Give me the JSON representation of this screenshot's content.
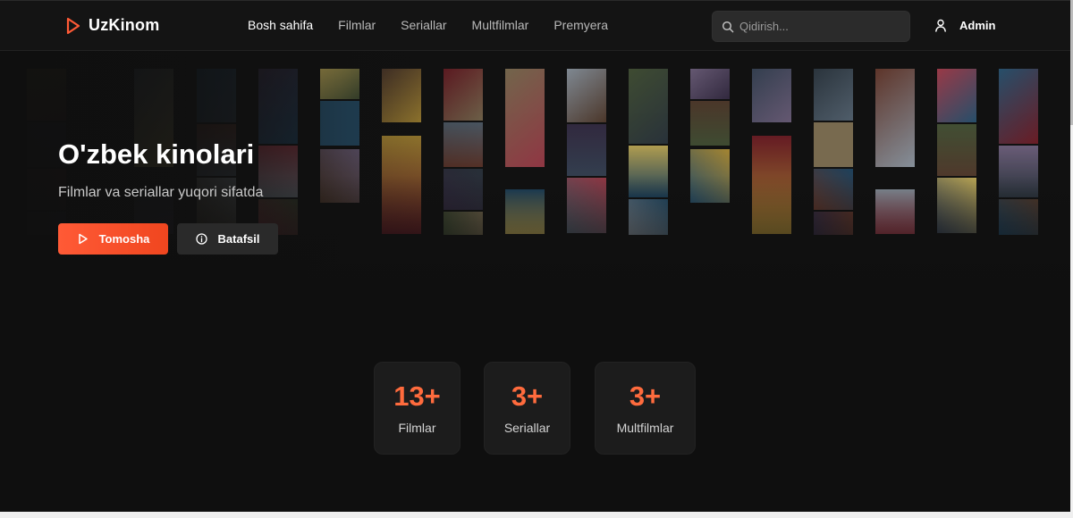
{
  "header": {
    "logo_text": "UzKinom",
    "nav": [
      {
        "label": "Bosh sahifa",
        "active": true
      },
      {
        "label": "Filmlar",
        "active": false
      },
      {
        "label": "Seriallar",
        "active": false
      },
      {
        "label": "Multfilmlar",
        "active": false
      },
      {
        "label": "Premyera",
        "active": false
      }
    ],
    "search": {
      "placeholder": "Qidirish...",
      "value": "",
      "icon": "search-icon"
    },
    "user": {
      "name": "Admin",
      "icon": "user-icon"
    }
  },
  "hero": {
    "title": "O'zbek kinolari",
    "subtitle": "Filmlar va seriallar yuqori sifatda",
    "primary_button": {
      "label": "Tomosha",
      "icon": "play-icon"
    },
    "secondary_button": {
      "label": "Batafsil",
      "icon": "info-icon"
    }
  },
  "stats": [
    {
      "value": "13+",
      "label": "Filmlar"
    },
    {
      "value": "3+",
      "label": "Seriallar"
    },
    {
      "value": "3+",
      "label": "Multfilmlar"
    }
  ],
  "colors": {
    "accent": "#ff5a36",
    "stat_value": "#ff6b3d",
    "background": "#0f0f0f",
    "header": "#141414",
    "card": "#1c1c1c"
  }
}
